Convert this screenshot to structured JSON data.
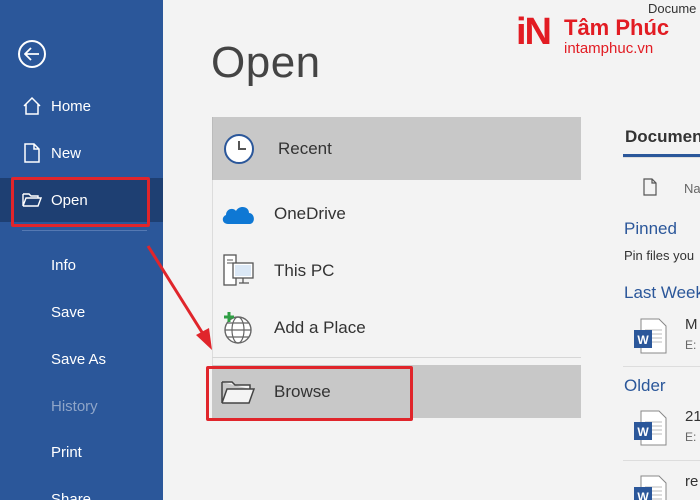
{
  "window": {
    "title_partial": "Docume"
  },
  "logo": {
    "mark": "iN",
    "name": "Tâm Phúc",
    "domain": "intamphuc.vn"
  },
  "sidebar": {
    "items": [
      {
        "label": "Home",
        "icon": "home-icon"
      },
      {
        "label": "New",
        "icon": "new-document-icon"
      },
      {
        "label": "Open",
        "icon": "open-folder-icon",
        "active": true
      },
      {
        "label": "Info"
      },
      {
        "label": "Save"
      },
      {
        "label": "Save As"
      },
      {
        "label": "History",
        "disabled": true
      },
      {
        "label": "Print"
      },
      {
        "label": "Share"
      }
    ]
  },
  "main": {
    "title": "Open",
    "locations": [
      {
        "label": "Recent",
        "icon": "clock-icon"
      },
      {
        "label": "OneDrive",
        "icon": "cloud-icon"
      },
      {
        "label": "This PC",
        "icon": "computer-icon"
      },
      {
        "label": "Add a Place",
        "icon": "add-place-globe-icon"
      },
      {
        "label": "Browse",
        "icon": "folder-icon"
      }
    ]
  },
  "right_panel": {
    "tab": "Documen",
    "column_name": "Na",
    "pinned_title": "Pinned",
    "pinned_hint": "Pin files you",
    "last_week_title": "Last Week",
    "older_title": "Older",
    "docs": [
      {
        "name": "M",
        "meta": "E:"
      },
      {
        "name": "21",
        "meta": "E:"
      },
      {
        "name": "re",
        "meta": ""
      }
    ]
  },
  "colors": {
    "sidebar": "#2b579a",
    "sidebar_active": "#1e3f72",
    "highlight": "#e0252b",
    "accent": "#2b579a",
    "brand": "#e21c23"
  }
}
